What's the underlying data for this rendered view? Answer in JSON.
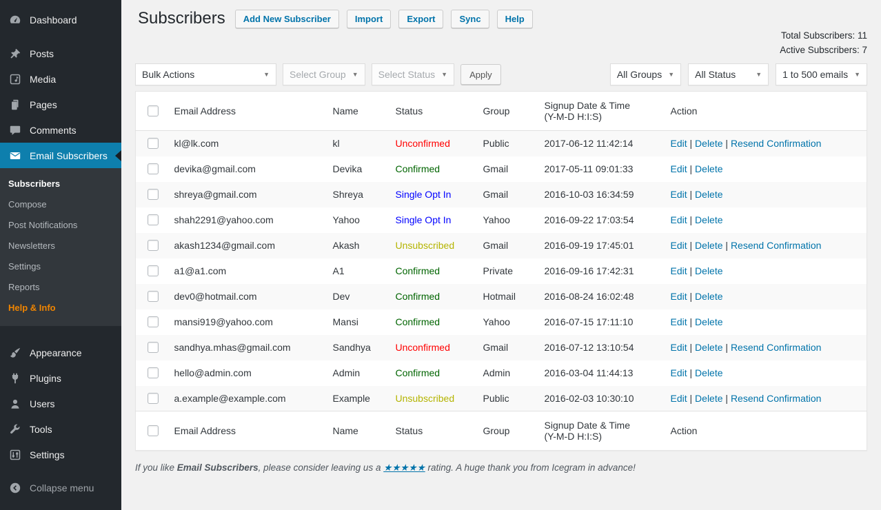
{
  "sidebar": {
    "items_top": [
      "Dashboard",
      "Posts",
      "Media",
      "Pages",
      "Comments",
      "Email Subscribers"
    ],
    "submenu": [
      "Subscribers",
      "Compose",
      "Post Notifications",
      "Newsletters",
      "Settings",
      "Reports",
      "Help & Info"
    ],
    "items_bottom": [
      "Appearance",
      "Plugins",
      "Users",
      "Tools",
      "Settings"
    ],
    "collapse_label": "Collapse menu"
  },
  "header": {
    "title": "Subscribers",
    "actions": [
      "Add New Subscriber",
      "Import",
      "Export",
      "Sync",
      "Help"
    ]
  },
  "stats": {
    "total": "Total Subscribers: 11",
    "active": "Active Subscribers: 7"
  },
  "filters": {
    "bulk_actions": "Bulk Actions",
    "select_group": "Select Group",
    "select_status": "Select Status",
    "apply": "Apply",
    "all_groups": "All Groups",
    "all_status": "All Status",
    "email_range": "1 to 500 emails",
    "caret": "▼"
  },
  "table": {
    "columns": [
      {
        "label": "Email Address"
      },
      {
        "label": "Name"
      },
      {
        "label": "Status"
      },
      {
        "label": "Group"
      },
      {
        "label": "Signup Date & Time",
        "sub": "(Y-M-D H:I:S)"
      },
      {
        "label": "Action"
      }
    ],
    "action_separator": " | ",
    "rows": [
      {
        "email": "kl@lk.com",
        "name": "kl",
        "status": "Unconfirmed",
        "status_key": "unconfirmed",
        "group": "Public",
        "signup": "2017-06-12 11:42:14",
        "actions": [
          "Edit",
          "Delete",
          "Resend Confirmation"
        ]
      },
      {
        "email": "devika@gmail.com",
        "name": "Devika",
        "status": "Confirmed",
        "status_key": "confirmed",
        "group": "Gmail",
        "signup": "2017-05-11 09:01:33",
        "actions": [
          "Edit",
          "Delete"
        ]
      },
      {
        "email": "shreya@gmail.com",
        "name": "Shreya",
        "status": "Single Opt In",
        "status_key": "single",
        "group": "Gmail",
        "signup": "2016-10-03 16:34:59",
        "actions": [
          "Edit",
          "Delete"
        ]
      },
      {
        "email": "shah2291@yahoo.com",
        "name": "Yahoo",
        "status": "Single Opt In",
        "status_key": "single",
        "group": "Yahoo",
        "signup": "2016-09-22 17:03:54",
        "actions": [
          "Edit",
          "Delete"
        ]
      },
      {
        "email": "akash1234@gmail.com",
        "name": "Akash",
        "status": "Unsubscribed",
        "status_key": "unsubscribed",
        "group": "Gmail",
        "signup": "2016-09-19 17:45:01",
        "actions": [
          "Edit",
          "Delete",
          "Resend Confirmation"
        ]
      },
      {
        "email": "a1@a1.com",
        "name": "A1",
        "status": "Confirmed",
        "status_key": "confirmed",
        "group": "Private",
        "signup": "2016-09-16 17:42:31",
        "actions": [
          "Edit",
          "Delete"
        ]
      },
      {
        "email": "dev0@hotmail.com",
        "name": "Dev",
        "status": "Confirmed",
        "status_key": "confirmed",
        "group": "Hotmail",
        "signup": "2016-08-24 16:02:48",
        "actions": [
          "Edit",
          "Delete"
        ]
      },
      {
        "email": "mansi919@yahoo.com",
        "name": "Mansi",
        "status": "Confirmed",
        "status_key": "confirmed",
        "group": "Yahoo",
        "signup": "2016-07-15 17:11:10",
        "actions": [
          "Edit",
          "Delete"
        ]
      },
      {
        "email": "sandhya.mhas@gmail.com",
        "name": "Sandhya",
        "status": "Unconfirmed",
        "status_key": "unconfirmed",
        "group": "Gmail",
        "signup": "2016-07-12 13:10:54",
        "actions": [
          "Edit",
          "Delete",
          "Resend Confirmation"
        ]
      },
      {
        "email": "hello@admin.com",
        "name": "Admin",
        "status": "Confirmed",
        "status_key": "confirmed",
        "group": "Admin",
        "signup": "2016-03-04 11:44:13",
        "actions": [
          "Edit",
          "Delete"
        ]
      },
      {
        "email": "a.example@example.com",
        "name": "Example",
        "status": "Unsubscribed",
        "status_key": "unsubscribed",
        "group": "Public",
        "signup": "2016-02-03 10:30:10",
        "actions": [
          "Edit",
          "Delete",
          "Resend Confirmation"
        ]
      }
    ]
  },
  "footer": {
    "pre": "If you like ",
    "brand": "Email Subscribers",
    "mid": ", please consider leaving us a ",
    "stars": "★★★★★",
    "post": " rating. A huge thank you from Icegram in advance!"
  },
  "colors": {
    "accent_link": "#0073aa",
    "active_menu": "#0e7fad",
    "sidebar_bg": "#23282d",
    "submenu_bg": "#32373c",
    "help_info": "#f18500",
    "status_confirmed": "#006400",
    "status_unconfirmed": "#ff0000",
    "status_single_opt_in": "#0000ff",
    "status_unsubscribed": "#b4b400"
  }
}
